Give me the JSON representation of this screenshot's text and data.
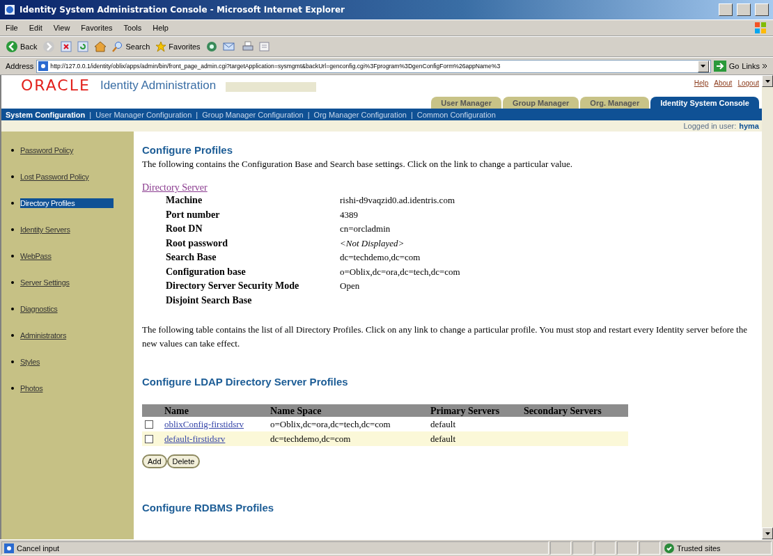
{
  "window": {
    "title": "Identity System Administration Console - Microsoft Internet Explorer"
  },
  "menu": [
    "File",
    "Edit",
    "View",
    "Favorites",
    "Tools",
    "Help"
  ],
  "toolbar": [
    {
      "kind": "back",
      "label": "Back"
    },
    {
      "kind": "forward"
    },
    {
      "kind": "stop"
    },
    {
      "kind": "refresh"
    },
    {
      "kind": "home"
    },
    {
      "kind": "search",
      "label": "Search"
    },
    {
      "kind": "favorites",
      "label": "Favorites"
    },
    {
      "kind": "media"
    },
    {
      "kind": "mail"
    },
    {
      "kind": "print"
    },
    {
      "kind": "edit"
    }
  ],
  "address": {
    "label": "Address",
    "value": "http://127.0.0.1/identity/oblix/apps/admin/bin/front_page_admin.cgi?targetApplication=sysmgmt&backUrl=genconfig.cgi%3Fprogram%3DgenConfigForm%26appName%3",
    "go": "Go",
    "links": "Links"
  },
  "header": {
    "logo": "ORACLE",
    "product": "Identity Administration",
    "links": [
      "Help",
      "About",
      "Logout"
    ]
  },
  "tabs": [
    {
      "label": "User Manager",
      "selected": false
    },
    {
      "label": "Group Manager",
      "selected": false
    },
    {
      "label": "Org. Manager",
      "selected": false
    },
    {
      "label": "Identity System Console",
      "selected": true
    }
  ],
  "subnav": [
    {
      "kind": "link",
      "label": "System Configuration",
      "selected": true
    },
    {
      "kind": "separator",
      "label": "|"
    },
    {
      "kind": "link",
      "label": "User Manager Configuration",
      "selected": false
    },
    {
      "kind": "separator",
      "label": "|"
    },
    {
      "kind": "link",
      "label": "Group Manager Configuration",
      "selected": false
    },
    {
      "kind": "separator",
      "label": "|"
    },
    {
      "kind": "link",
      "label": "Org Manager Configuration",
      "selected": false
    },
    {
      "kind": "separator",
      "label": "|"
    },
    {
      "kind": "link",
      "label": "Common Configuration",
      "selected": false
    }
  ],
  "logged_in": {
    "label": "Logged in user:",
    "user": "hyma"
  },
  "sidebar": {
    "items": [
      {
        "label": "Password Policy",
        "selected": false
      },
      {
        "label": "Lost Password Policy",
        "selected": false
      },
      {
        "label": "Directory Profiles",
        "selected": true
      },
      {
        "label": "Identity Servers",
        "selected": false
      },
      {
        "label": "WebPass",
        "selected": false
      },
      {
        "label": "Server Settings",
        "selected": false
      },
      {
        "label": "Diagnostics",
        "selected": false
      },
      {
        "label": "Administrators",
        "selected": false
      },
      {
        "label": "Styles",
        "selected": false
      },
      {
        "label": "Photos",
        "selected": false
      }
    ]
  },
  "content": {
    "title": "Configure Profiles",
    "intro": "The following contains the Configuration Base and Search base settings. Click on the link to change a particular value.",
    "directory_server": {
      "link": "Directory Server",
      "fields": [
        {
          "label": "Machine",
          "value": "rishi-d9vaqzid0.ad.identris.com"
        },
        {
          "label": "Port number",
          "value": "4389"
        },
        {
          "label": "Root DN",
          "value": "cn=orcladmin"
        },
        {
          "label": "Root password",
          "value": "<Not Displayed>",
          "kind": "italic"
        },
        {
          "label": "Search Base",
          "value": "dc=techdemo,dc=com"
        },
        {
          "label": "Configuration base",
          "value": "o=Oblix,dc=ora,dc=tech,dc=com"
        },
        {
          "label": "Directory Server Security Mode",
          "value": "Open"
        },
        {
          "label": "Disjoint Search Base"
        }
      ]
    },
    "table_intro": "The following table contains the list of all Directory Profiles. Click on any link to change a particular profile. You must stop and restart every Identity server before the new values can take effect.",
    "ldap_title": "Configure LDAP Directory Server Profiles",
    "table": {
      "columns": [
        "Name",
        "Name Space",
        "Primary Servers",
        "Secondary Servers"
      ],
      "rows": [
        {
          "checked": false,
          "name": "oblixConfig-firstidsrv",
          "name_space": "o=Oblix,dc=ora,dc=tech,dc=com",
          "primary": "default"
        },
        {
          "checked": false,
          "name": "default-firstidsrv",
          "name_space": "dc=techdemo,dc=com",
          "primary": "default"
        }
      ]
    },
    "buttons": [
      "Add",
      "Delete"
    ],
    "rdbms_title": "Configure RDBMS Profiles"
  },
  "status_bar": {
    "text": "Cancel input",
    "zone": "Trusted sites"
  }
}
